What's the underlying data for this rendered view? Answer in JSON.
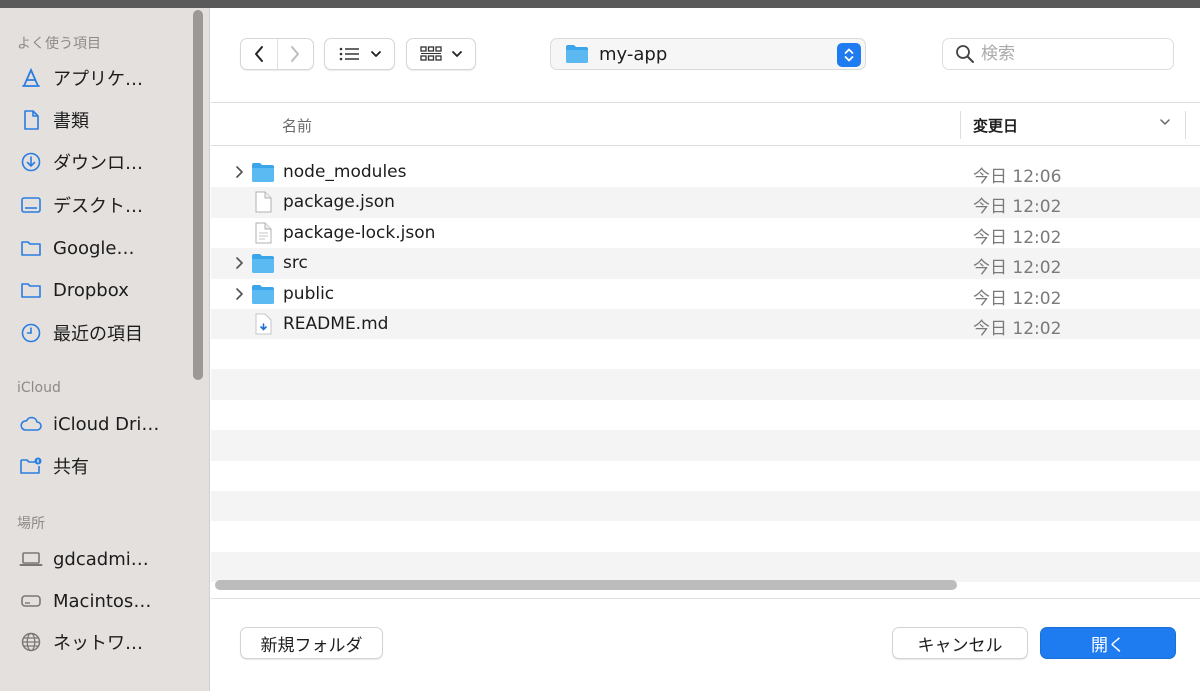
{
  "sidebar": {
    "favorites_header": "よく使う項目",
    "favorites": [
      {
        "label": "アプリケ…",
        "icon": "applications-icon"
      },
      {
        "label": "書類",
        "icon": "document-icon"
      },
      {
        "label": "ダウンロ…",
        "icon": "downloads-icon"
      },
      {
        "label": "デスクト…",
        "icon": "desktop-icon"
      },
      {
        "label": "Google…",
        "icon": "folder-icon"
      },
      {
        "label": "Dropbox",
        "icon": "folder-icon"
      },
      {
        "label": "最近の項目",
        "icon": "clock-icon"
      }
    ],
    "icloud_header": "iCloud",
    "icloud": [
      {
        "label": "iCloud Dri…",
        "icon": "cloud-icon"
      },
      {
        "label": "共有",
        "icon": "shared-folder-icon"
      }
    ],
    "locations_header": "場所",
    "locations": [
      {
        "label": "gdcadmi…",
        "icon": "laptop-icon"
      },
      {
        "label": "Macintos…",
        "icon": "disk-icon"
      },
      {
        "label": "ネットワ…",
        "icon": "network-icon"
      }
    ]
  },
  "toolbar": {
    "path_folder": "my-app",
    "search_placeholder": "検索"
  },
  "list": {
    "column_name": "名前",
    "column_date": "変更日",
    "rows": [
      {
        "name": "node_modules",
        "date": "今日 12:06",
        "kind": "folder",
        "expandable": true
      },
      {
        "name": "package.json",
        "date": "今日 12:02",
        "kind": "file",
        "expandable": false
      },
      {
        "name": "package-lock.json",
        "date": "今日 12:02",
        "kind": "file",
        "expandable": false
      },
      {
        "name": "src",
        "date": "今日 12:02",
        "kind": "folder",
        "expandable": true
      },
      {
        "name": "public",
        "date": "今日 12:02",
        "kind": "folder",
        "expandable": true
      },
      {
        "name": "README.md",
        "date": "今日 12:02",
        "kind": "markdown",
        "expandable": false
      }
    ]
  },
  "footer": {
    "new_folder": "新規フォルダ",
    "cancel": "キャンセル",
    "open": "開く"
  },
  "colors": {
    "accent": "#1f7cf0",
    "folder": "#3aa5e8",
    "sidebar_icon": "#2a7de1"
  }
}
